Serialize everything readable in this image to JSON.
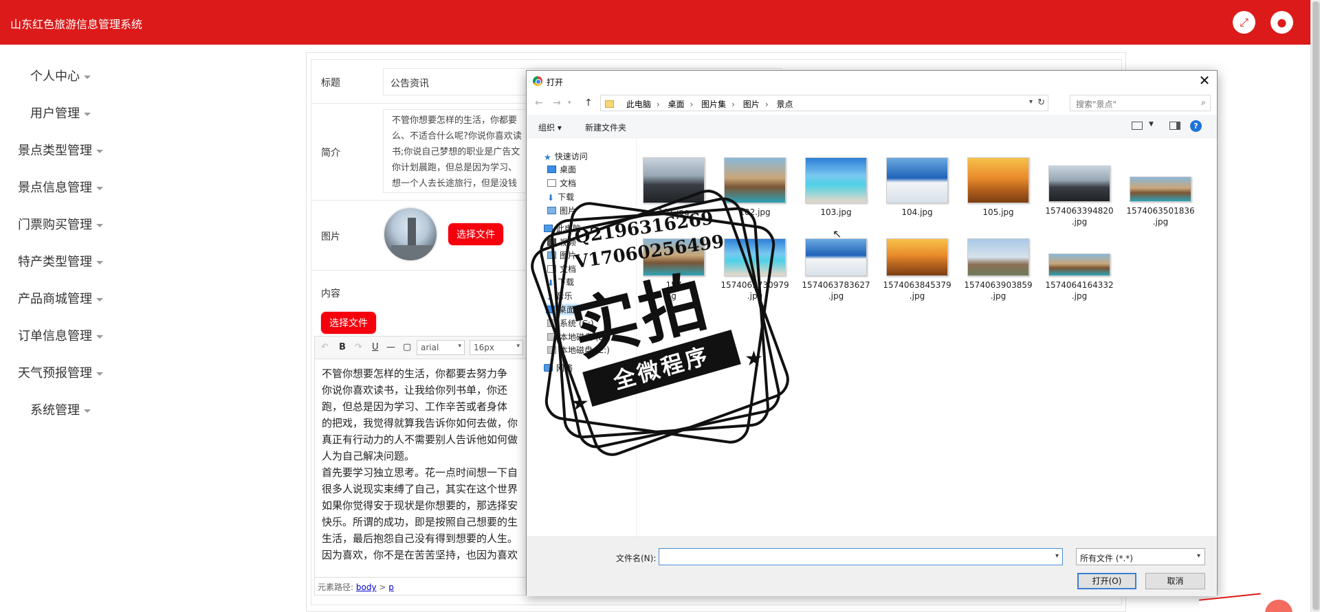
{
  "app": {
    "title": "山东红色旅游信息管理系统",
    "accent_color": "#dc1a1a",
    "header_icons": [
      "expand-icon",
      "user-icon"
    ]
  },
  "sidebar": {
    "items": [
      {
        "label": "个人中心"
      },
      {
        "label": "用户管理"
      },
      {
        "label": "景点类型管理"
      },
      {
        "label": "景点信息管理"
      },
      {
        "label": "门票购买管理"
      },
      {
        "label": "特产类型管理"
      },
      {
        "label": "产品商城管理"
      },
      {
        "label": "订单信息管理"
      },
      {
        "label": "天气预报管理"
      },
      {
        "label": "系统管理"
      }
    ]
  },
  "form": {
    "title_label": "标题",
    "title_value": "公告资讯",
    "intro_label": "简介",
    "intro_lines": [
      "不管你想要怎样的生活，你都要",
      "么、不适合什么呢?你说你喜欢读",
      "书;你说自己梦想的职业是广告文",
      "你计划晨跑，但总是因为学习、",
      "想一个人去长途旅行，但是没钱"
    ],
    "image_label": "图片",
    "choose_file_label": "选择文件",
    "content_label": "内容",
    "content_choose_file_label": "选择文件"
  },
  "editor": {
    "font_family": "arial",
    "font_size": "16px",
    "paragraphs": [
      "不管你想要怎样的生活，你都要去努力争",
      "你说你喜欢读书，让我给你列书单，你还",
      "跑，但总是因为学习、工作辛苦或者身体",
      "的把戏，我觉得就算我告诉你如何去做，你",
      "真正有行动力的人不需要别人告诉他如何做",
      "人为自己解决问题。",
      "首先要学习独立思考。花一点时间想一下自",
      "很多人说现实束缚了自己，其实在这个世界",
      "如果你觉得安于现状是你想要的，那选择安",
      "快乐。所谓的成功，即是按照自己想要的生",
      "生活，最后抱怨自己没有得到想要的人生。",
      "因为喜欢，你不是在苦苦坚持，也因为喜欢"
    ],
    "status_prefix": "元素路径:",
    "path_body": "body",
    "path_sep": ">",
    "path_p": "p"
  },
  "dialog": {
    "title": "打开",
    "close": "✕",
    "breadcrumbs": [
      "此电脑",
      "桌面",
      "图片集",
      "图片",
      "景点"
    ],
    "crumb_sep": "›",
    "search_placeholder": "搜索\"景点\"",
    "organize_label": "组织 ▾",
    "new_folder_label": "新建文件夹",
    "help": "?",
    "nav": [
      {
        "label": "快速访问",
        "icon": "star-icon"
      },
      {
        "label": "桌面",
        "icon": "desktop-icon"
      },
      {
        "label": "文档",
        "icon": "document-icon"
      },
      {
        "label": "下载",
        "icon": "download-icon"
      },
      {
        "label": "图片",
        "icon": "picture-icon"
      },
      {
        "label": "此电脑",
        "icon": "computer-icon"
      },
      {
        "label": "视频",
        "icon": "video-icon"
      },
      {
        "label": "图片",
        "icon": "picture-icon"
      },
      {
        "label": "文档",
        "icon": "document-icon"
      },
      {
        "label": "下载",
        "icon": "download-icon"
      },
      {
        "label": "音乐",
        "icon": "music-icon"
      },
      {
        "label": "桌面",
        "icon": "desktop-icon"
      },
      {
        "label": "系统 (C:)",
        "icon": "drive-icon"
      },
      {
        "label": "本地磁盘 (D:)",
        "icon": "drive-icon"
      },
      {
        "label": "本地磁盘 (E:)",
        "icon": "drive-icon"
      },
      {
        "label": "网络",
        "icon": "network-icon"
      }
    ],
    "files": [
      {
        "line1": "101.jpg",
        "line2": ""
      },
      {
        "line1": "102.jpg",
        "line2": ""
      },
      {
        "line1": "103.jpg",
        "line2": ""
      },
      {
        "line1": "104.jpg",
        "line2": ""
      },
      {
        "line1": "105.jpg",
        "line2": ""
      },
      {
        "line1": "1574063394820",
        "line2": ".jpg"
      },
      {
        "line1": "1574063501836",
        "line2": ".jpg"
      },
      {
        "line1": "157",
        "line2": "g"
      },
      {
        "line1": "1574063730979",
        "line2": ".jpg"
      },
      {
        "line1": "1574063783627",
        "line2": ".jpg"
      },
      {
        "line1": "1574063845379",
        "line2": ".jpg"
      },
      {
        "line1": "1574063903859",
        "line2": ".jpg"
      },
      {
        "line1": "1574064164332",
        "line2": ".jpg"
      }
    ],
    "filename_label": "文件名(N):",
    "filename_value": "",
    "filetype_value": "所有文件 (*.*)",
    "open_button": "打开(O)",
    "cancel_button": "取消"
  },
  "stamp": {
    "qq": "Q2196316269",
    "vx": "V17060256499",
    "big": "实拍",
    "ribbon": "全微程序"
  }
}
